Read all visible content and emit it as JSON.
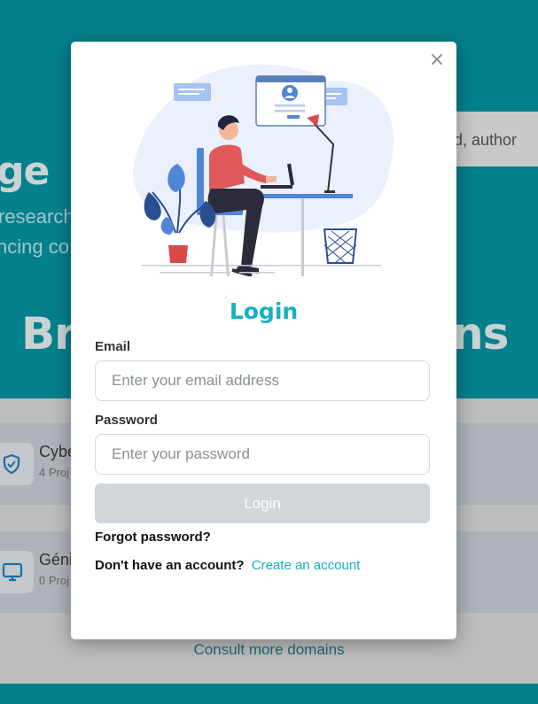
{
  "background": {
    "hero_title": "ge",
    "hero_line1": "research",
    "hero_line2": "ncing co",
    "search_text": "d, author",
    "heading_left": "Br",
    "heading_right": "ns",
    "cards": [
      {
        "title": "Cybe",
        "subtitle": "4 Proj"
      },
      {
        "title": "Géni",
        "subtitle": "0 Proj"
      }
    ],
    "consult_link": "Consult more domains"
  },
  "modal": {
    "close_label": "×",
    "title": "Login",
    "email": {
      "label": "Email",
      "placeholder": "Enter your email address",
      "value": ""
    },
    "password": {
      "label": "Password",
      "placeholder": "Enter your password",
      "value": ""
    },
    "submit_label": "Login",
    "forgot_label": "Forgot password?",
    "signup_question": "Don't have an account?",
    "signup_link": "Create an account"
  },
  "icons": {
    "shield": "shield-icon",
    "monitor": "monitor-icon",
    "close": "close-icon"
  },
  "colors": {
    "accent": "#16b0c4",
    "hero_bg": "#04808c",
    "button_disabled": "#d2d5da"
  }
}
